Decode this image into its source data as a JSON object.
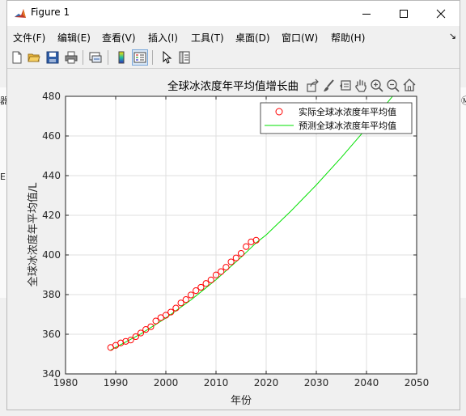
{
  "window": {
    "title": "Figure 1"
  },
  "menu": [
    "文件(F)",
    "编辑(E)",
    "查看(V)",
    "插入(I)",
    "工具(T)",
    "桌面(D)",
    "窗口(W)",
    "帮助(H)"
  ],
  "menu_overflow": "↘",
  "background_fragments": {
    "left_top": "器",
    "left_bottom": "E",
    "right_top": "Ⓜ"
  },
  "toolbar_icons": [
    "new-figure-icon",
    "open-file-icon",
    "save-icon",
    "print-icon",
    "link-plot-icon",
    "insert-colorbar-icon",
    "insert-legend-icon",
    "edit-plot-icon",
    "property-inspector-icon"
  ],
  "axes_toolbar_icons": [
    "export-icon",
    "brush-icon",
    "data-tips-icon",
    "pan-icon",
    "zoom-in-icon",
    "zoom-out-icon",
    "home-icon"
  ],
  "chart_data": {
    "type": "line",
    "title": "全球冰浓度年平均值增长曲",
    "xlabel": "年份",
    "ylabel": "全球冰浓度年平均值/L",
    "xlim": [
      1980,
      2050
    ],
    "ylim": [
      340,
      480
    ],
    "xticks": [
      1980,
      1990,
      2000,
      2010,
      2020,
      2030,
      2040,
      2050
    ],
    "yticks": [
      340,
      360,
      380,
      400,
      420,
      440,
      460,
      480
    ],
    "grid": true,
    "legend_position": "top-right",
    "series": [
      {
        "name": "实际全球冰浓度年平均值",
        "style": "markers",
        "marker": "circle",
        "color": "#ff0000",
        "x": [
          1989,
          1990,
          1991,
          1992,
          1993,
          1994,
          1995,
          1996,
          1997,
          1998,
          1999,
          2000,
          2001,
          2002,
          2003,
          2004,
          2005,
          2006,
          2007,
          2008,
          2009,
          2010,
          2011,
          2012,
          2013,
          2014,
          2015,
          2016,
          2017,
          2018
        ],
        "y": [
          353.3,
          354.4,
          355.6,
          356.4,
          357.1,
          358.8,
          360.6,
          362.4,
          363.8,
          366.7,
          368.4,
          369.6,
          371.2,
          373.2,
          375.8,
          377.5,
          379.8,
          382.0,
          383.7,
          385.6,
          387.4,
          389.9,
          391.6,
          393.8,
          396.5,
          398.5,
          400.8,
          404.2,
          406.6,
          407.4
        ]
      },
      {
        "name": "预测全球冰浓度年平均值",
        "style": "line",
        "color": "#00e000",
        "x": [
          1989,
          1995,
          2000,
          2005,
          2010,
          2015,
          2018,
          2020,
          2025,
          2030,
          2035,
          2040,
          2045,
          2050
        ],
        "y": [
          352.0,
          360.2,
          368.2,
          377.3,
          387.5,
          398.8,
          406.1,
          410.1,
          422.3,
          435.3,
          449.2,
          463.9,
          479.4,
          495.8
        ]
      }
    ]
  }
}
